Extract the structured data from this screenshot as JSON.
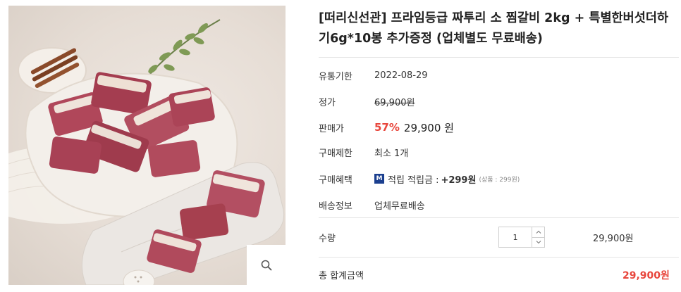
{
  "product": {
    "title": "[떠리신선관] 프라임등급 짜투리 소 찜갈비 2kg + 특별한버섯더하기6g*10봉 추가증정 (업체별도 무료배송)",
    "zoom_icon": "magnifier-icon"
  },
  "details": {
    "expiry_label": "유통기한",
    "expiry_value": "2022-08-29",
    "list_price_label": "정가",
    "list_price_value": "69,900원",
    "sale_label": "판매가",
    "sale_percent": "57%",
    "sale_price": "29,900 원",
    "limit_label": "구매제한",
    "limit_value": "최소 1개",
    "benefit_label": "구매혜택",
    "benefit_badge": "M",
    "benefit_text": "적립 적립금 :",
    "benefit_points": "+299원",
    "benefit_note": "(상품 : 299원)",
    "shipping_label": "배송정보",
    "shipping_value": "업체무료배송"
  },
  "quantity": {
    "label": "수량",
    "value": "1",
    "line_price": "29,900원"
  },
  "total": {
    "label": "총 합계금액",
    "price": "29,900원"
  },
  "colors": {
    "accent_red": "#e8463c",
    "badge_blue": "#1b3f8f"
  }
}
